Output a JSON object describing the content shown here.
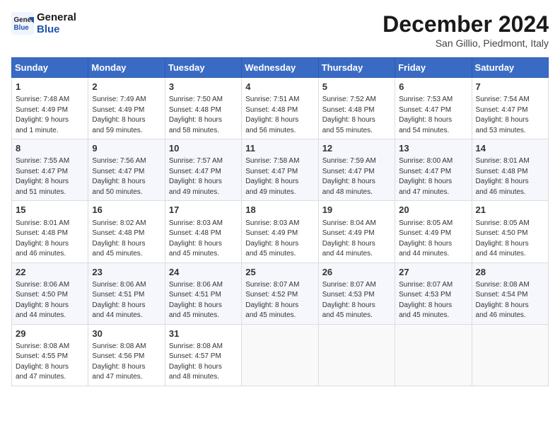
{
  "header": {
    "logo_line1": "General",
    "logo_line2": "Blue",
    "month": "December 2024",
    "location": "San Gillio, Piedmont, Italy"
  },
  "days_of_week": [
    "Sunday",
    "Monday",
    "Tuesday",
    "Wednesday",
    "Thursday",
    "Friday",
    "Saturday"
  ],
  "weeks": [
    [
      {
        "day": "1",
        "info": "Sunrise: 7:48 AM\nSunset: 4:49 PM\nDaylight: 9 hours\nand 1 minute."
      },
      {
        "day": "2",
        "info": "Sunrise: 7:49 AM\nSunset: 4:49 PM\nDaylight: 8 hours\nand 59 minutes."
      },
      {
        "day": "3",
        "info": "Sunrise: 7:50 AM\nSunset: 4:48 PM\nDaylight: 8 hours\nand 58 minutes."
      },
      {
        "day": "4",
        "info": "Sunrise: 7:51 AM\nSunset: 4:48 PM\nDaylight: 8 hours\nand 56 minutes."
      },
      {
        "day": "5",
        "info": "Sunrise: 7:52 AM\nSunset: 4:48 PM\nDaylight: 8 hours\nand 55 minutes."
      },
      {
        "day": "6",
        "info": "Sunrise: 7:53 AM\nSunset: 4:47 PM\nDaylight: 8 hours\nand 54 minutes."
      },
      {
        "day": "7",
        "info": "Sunrise: 7:54 AM\nSunset: 4:47 PM\nDaylight: 8 hours\nand 53 minutes."
      }
    ],
    [
      {
        "day": "8",
        "info": "Sunrise: 7:55 AM\nSunset: 4:47 PM\nDaylight: 8 hours\nand 51 minutes."
      },
      {
        "day": "9",
        "info": "Sunrise: 7:56 AM\nSunset: 4:47 PM\nDaylight: 8 hours\nand 50 minutes."
      },
      {
        "day": "10",
        "info": "Sunrise: 7:57 AM\nSunset: 4:47 PM\nDaylight: 8 hours\nand 49 minutes."
      },
      {
        "day": "11",
        "info": "Sunrise: 7:58 AM\nSunset: 4:47 PM\nDaylight: 8 hours\nand 49 minutes."
      },
      {
        "day": "12",
        "info": "Sunrise: 7:59 AM\nSunset: 4:47 PM\nDaylight: 8 hours\nand 48 minutes."
      },
      {
        "day": "13",
        "info": "Sunrise: 8:00 AM\nSunset: 4:47 PM\nDaylight: 8 hours\nand 47 minutes."
      },
      {
        "day": "14",
        "info": "Sunrise: 8:01 AM\nSunset: 4:48 PM\nDaylight: 8 hours\nand 46 minutes."
      }
    ],
    [
      {
        "day": "15",
        "info": "Sunrise: 8:01 AM\nSunset: 4:48 PM\nDaylight: 8 hours\nand 46 minutes."
      },
      {
        "day": "16",
        "info": "Sunrise: 8:02 AM\nSunset: 4:48 PM\nDaylight: 8 hours\nand 45 minutes."
      },
      {
        "day": "17",
        "info": "Sunrise: 8:03 AM\nSunset: 4:48 PM\nDaylight: 8 hours\nand 45 minutes."
      },
      {
        "day": "18",
        "info": "Sunrise: 8:03 AM\nSunset: 4:49 PM\nDaylight: 8 hours\nand 45 minutes."
      },
      {
        "day": "19",
        "info": "Sunrise: 8:04 AM\nSunset: 4:49 PM\nDaylight: 8 hours\nand 44 minutes."
      },
      {
        "day": "20",
        "info": "Sunrise: 8:05 AM\nSunset: 4:49 PM\nDaylight: 8 hours\nand 44 minutes."
      },
      {
        "day": "21",
        "info": "Sunrise: 8:05 AM\nSunset: 4:50 PM\nDaylight: 8 hours\nand 44 minutes."
      }
    ],
    [
      {
        "day": "22",
        "info": "Sunrise: 8:06 AM\nSunset: 4:50 PM\nDaylight: 8 hours\nand 44 minutes."
      },
      {
        "day": "23",
        "info": "Sunrise: 8:06 AM\nSunset: 4:51 PM\nDaylight: 8 hours\nand 44 minutes."
      },
      {
        "day": "24",
        "info": "Sunrise: 8:06 AM\nSunset: 4:51 PM\nDaylight: 8 hours\nand 45 minutes."
      },
      {
        "day": "25",
        "info": "Sunrise: 8:07 AM\nSunset: 4:52 PM\nDaylight: 8 hours\nand 45 minutes."
      },
      {
        "day": "26",
        "info": "Sunrise: 8:07 AM\nSunset: 4:53 PM\nDaylight: 8 hours\nand 45 minutes."
      },
      {
        "day": "27",
        "info": "Sunrise: 8:07 AM\nSunset: 4:53 PM\nDaylight: 8 hours\nand 45 minutes."
      },
      {
        "day": "28",
        "info": "Sunrise: 8:08 AM\nSunset: 4:54 PM\nDaylight: 8 hours\nand 46 minutes."
      }
    ],
    [
      {
        "day": "29",
        "info": "Sunrise: 8:08 AM\nSunset: 4:55 PM\nDaylight: 8 hours\nand 47 minutes."
      },
      {
        "day": "30",
        "info": "Sunrise: 8:08 AM\nSunset: 4:56 PM\nDaylight: 8 hours\nand 47 minutes."
      },
      {
        "day": "31",
        "info": "Sunrise: 8:08 AM\nSunset: 4:57 PM\nDaylight: 8 hours\nand 48 minutes."
      },
      {
        "day": "",
        "info": ""
      },
      {
        "day": "",
        "info": ""
      },
      {
        "day": "",
        "info": ""
      },
      {
        "day": "",
        "info": ""
      }
    ]
  ]
}
